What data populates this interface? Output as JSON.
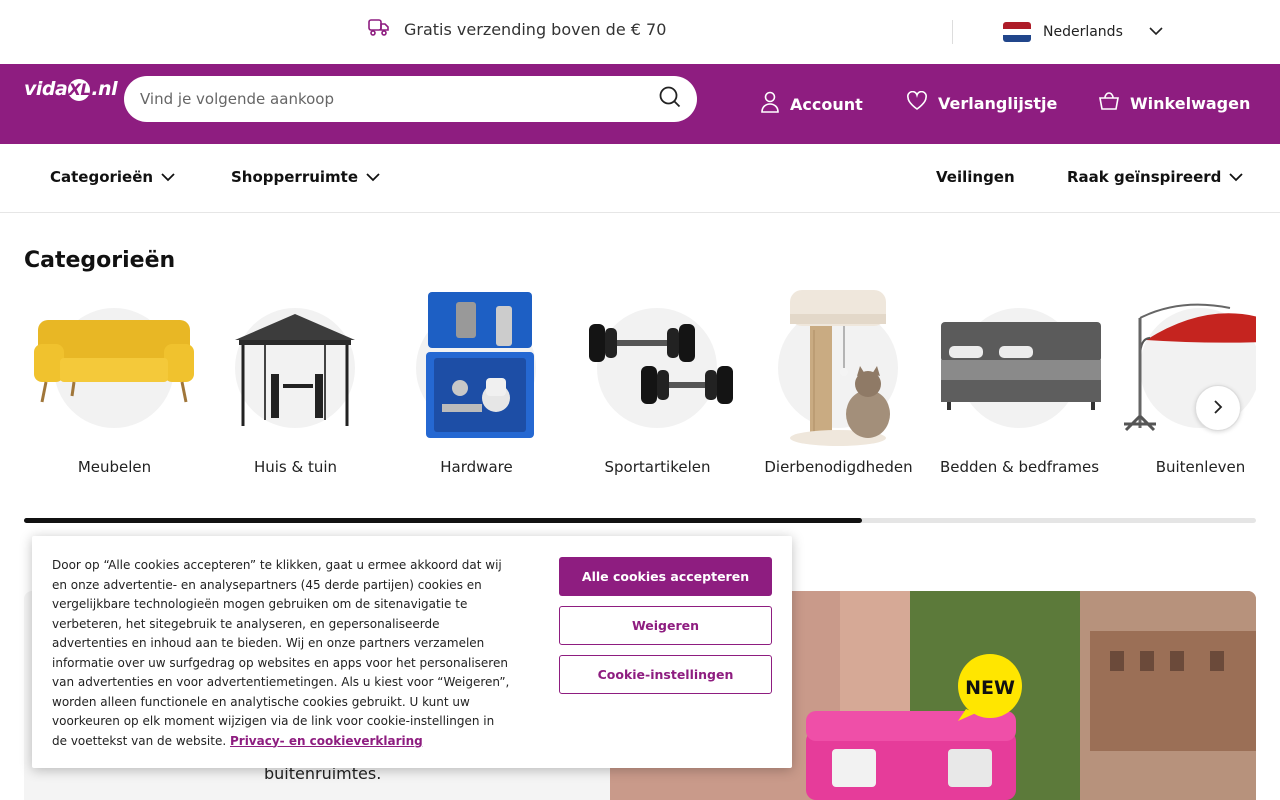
{
  "topbar": {
    "promo": "Gratis verzending boven de € 70",
    "language": "Nederlands"
  },
  "header": {
    "logo": {
      "pre": "vida",
      "mark": "XL",
      "post": ".nl"
    },
    "search_placeholder": "Vind je volgende aankoop",
    "account": "Account",
    "wishlist": "Verlanglijstje",
    "cart": "Winkelwagen"
  },
  "nav": {
    "categories": "Categorieën",
    "shopper": "Shopperruimte",
    "auctions": "Veilingen",
    "inspired": "Raak geïnspireerd"
  },
  "categories": {
    "title": "Categorieën",
    "items": [
      {
        "label": "Meubelen",
        "icon": "sofa-image"
      },
      {
        "label": "Huis & tuin",
        "icon": "gazebo-image"
      },
      {
        "label": "Hardware",
        "icon": "spray-gun-kit-image"
      },
      {
        "label": "Sportartikelen",
        "icon": "dumbbells-image"
      },
      {
        "label": "Dierbenodigdheden",
        "icon": "cat-tree-image"
      },
      {
        "label": "Bedden & bedframes",
        "icon": "bed-image"
      },
      {
        "label": "Buitenleven",
        "icon": "parasol-image"
      }
    ],
    "scroll_progress": 0.68
  },
  "promo": {
    "text": "buitenruimtes.",
    "badge": "NEW"
  },
  "cookie": {
    "text": "Door op “Alle cookies accepteren” te klikken, gaat u ermee akkoord dat wij en onze advertentie- en analysepartners (45 derde partijen) cookies en vergelijkbare technologieën mogen gebruiken om de sitenavigatie te verbeteren, het sitegebruik te analyseren, en gepersonaliseerde advertenties en inhoud aan te bieden. Wij en onze partners verzamelen informatie over uw surfgedrag op websites en apps voor het personaliseren van advertenties en voor advertentiemetingen. Als u kiest voor “Weigeren”, worden alleen functionele en analytische cookies gebruikt. U kunt uw voorkeuren op elk moment wijzigen via de link voor cookie-instellingen in de voettekst van de website.",
    "link": "Privacy- en cookieverklaring",
    "accept": "Alle cookies accepteren",
    "reject": "Weigeren",
    "settings": "Cookie-instellingen"
  },
  "colors": {
    "brand": "#8e1d80",
    "badge": "#ffe600"
  }
}
